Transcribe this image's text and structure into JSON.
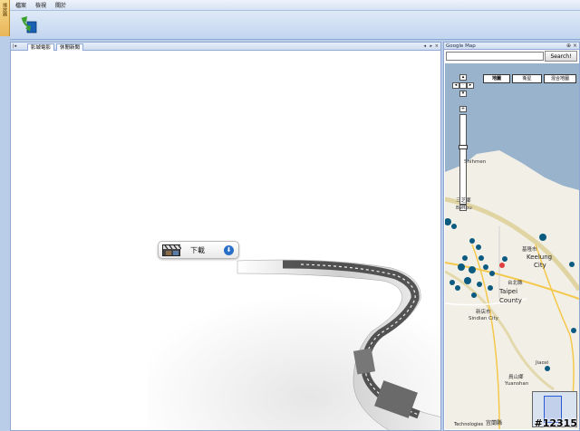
{
  "side_panel": {
    "label": "播放器"
  },
  "menu": {
    "items": [
      "檔案",
      "檢視",
      "關於"
    ]
  },
  "tabs": {
    "items": [
      "影城電影",
      "休閒新聞"
    ],
    "active": 0
  },
  "download": {
    "label": "下載"
  },
  "map_panel": {
    "title": "Google Map",
    "search_placeholder": "",
    "search_button": "Search!",
    "map_types": [
      "地圖",
      "衛星",
      "混合地圖"
    ],
    "active_map_type": 0,
    "places": {
      "shihmen": "Shihmen",
      "sanjhih": "三芝鄉",
      "beitou": "Beitou",
      "keelung_cn": "基隆市",
      "keelung_en": "Keelung",
      "city": "City",
      "taipei_cn": "台北縣",
      "taipei_en": "Taipei",
      "county": "County",
      "sindian_cn": "新店市",
      "sindian_en": "Sindian City",
      "jiaoxi": "Jiaoxi",
      "yuanshan_cn": "員山鄉",
      "yuanshan_en": "Yuanshan",
      "yilan": "宜蘭縣"
    },
    "copyright": "Technologies"
  },
  "watermark": "#12315"
}
